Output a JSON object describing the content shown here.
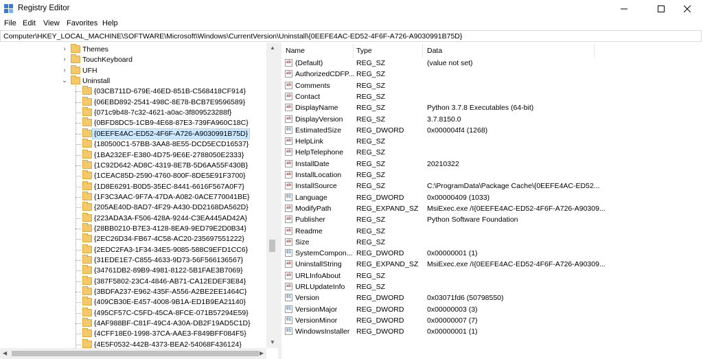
{
  "window": {
    "title": "Registry Editor",
    "minimize": "—",
    "maximize": "☐",
    "close": "✕"
  },
  "menu": [
    "File",
    "Edit",
    "View",
    "Favorites",
    "Help"
  ],
  "address": "Computer\\HKEY_LOCAL_MACHINE\\SOFTWARE\\Microsoft\\Windows\\CurrentVersion\\Uninstall\\{0EEFE4AC-ED52-4F6F-A726-A9030991B75D}",
  "tree": {
    "parents": [
      {
        "label": "Themes",
        "expander": "›"
      },
      {
        "label": "TouchKeyboard",
        "expander": "›"
      },
      {
        "label": "UFH",
        "expander": "›"
      },
      {
        "label": "Uninstall",
        "expander": "⌄"
      }
    ],
    "children": [
      "{03CB711D-679E-46ED-851B-C568418CF914}",
      "{06EBD892-2541-498C-8E78-BCB7E9596589}",
      "{071c9b48-7c32-4621-a0ac-3f809523288f}",
      "{0BFD8DC5-1CB9-4E68-87E3-739FA960C18C}",
      "{0EEFE4AC-ED52-4F6F-A726-A9030991B75D}",
      "{180500C1-57BB-3AA8-8E55-DCD5ECD16537}",
      "{1BA232EF-E380-4D75-9E6E-2788050E2333}",
      "{1C92D642-AD8C-4319-8E7B-5D6AA55F430B}",
      "{1CEAC85D-2590-4760-800F-8DE5E91F3700}",
      "{1D8E6291-B0D5-35EC-8441-6616F567A0F7}",
      "{1F3C3AAC-9F7A-47DA-A082-0ACE770041BE}",
      "{205AE40D-8AD7-4F29-A430-DD2168DA562D}",
      "{223ADA3A-F506-428A-9244-C3EA445AD42A}",
      "{28BB0210-B7E3-4128-8EA9-9ED79E2D0B34}",
      "{2EC26D34-FB67-4C58-AC20-235697551222}",
      "{2EDC2FA3-1F34-34E5-9085-588C9EFD1CC6}",
      "{31EDE1E7-C855-4633-9D73-56F566136567}",
      "{34761DB2-89B9-4981-8122-5B1FAE3B7069}",
      "{387F5802-23C4-4846-AB71-CA12EDEF3E84}",
      "{3BDFA237-E962-435F-A556-A2BE2EE1464C}",
      "{409CB30E-E457-4008-9B1A-ED1B9EA21140}",
      "{495CF57C-C5FD-45CA-8FCE-071B57294E59}",
      "{4AF988BF-C81F-49C4-A30A-DB2F19AD5C1D}",
      "{4CFF18E0-1998-37CA-AAE3-F849BFF084F5}",
      "{4E5F0532-442B-4373-BEA2-54068F436124}"
    ],
    "selected_index": 4
  },
  "list": {
    "headers": {
      "name": "Name",
      "type": "Type",
      "data": "Data"
    },
    "rows": [
      {
        "name": "(Default)",
        "type": "REG_SZ",
        "data": "(value not set)",
        "icon": "ab"
      },
      {
        "name": "AuthorizedCDFP...",
        "type": "REG_SZ",
        "data": "",
        "icon": "ab"
      },
      {
        "name": "Comments",
        "type": "REG_SZ",
        "data": "",
        "icon": "ab"
      },
      {
        "name": "Contact",
        "type": "REG_SZ",
        "data": "",
        "icon": "ab"
      },
      {
        "name": "DisplayName",
        "type": "REG_SZ",
        "data": "Python 3.7.8 Executables (64-bit)",
        "icon": "ab"
      },
      {
        "name": "DisplayVersion",
        "type": "REG_SZ",
        "data": "3.7.8150.0",
        "icon": "ab"
      },
      {
        "name": "EstimatedSize",
        "type": "REG_DWORD",
        "data": "0x000004f4 (1268)",
        "icon": "01"
      },
      {
        "name": "HelpLink",
        "type": "REG_SZ",
        "data": "",
        "icon": "ab"
      },
      {
        "name": "HelpTelephone",
        "type": "REG_SZ",
        "data": "",
        "icon": "ab"
      },
      {
        "name": "InstallDate",
        "type": "REG_SZ",
        "data": "20210322",
        "icon": "ab"
      },
      {
        "name": "InstallLocation",
        "type": "REG_SZ",
        "data": "",
        "icon": "ab"
      },
      {
        "name": "InstallSource",
        "type": "REG_SZ",
        "data": "C:\\ProgramData\\Package Cache\\{0EEFE4AC-ED52...",
        "icon": "ab"
      },
      {
        "name": "Language",
        "type": "REG_DWORD",
        "data": "0x00000409 (1033)",
        "icon": "01"
      },
      {
        "name": "ModifyPath",
        "type": "REG_EXPAND_SZ",
        "data": "MsiExec.exe /I{0EEFE4AC-ED52-4F6F-A726-A90309...",
        "icon": "ab"
      },
      {
        "name": "Publisher",
        "type": "REG_SZ",
        "data": "Python Software Foundation",
        "icon": "ab"
      },
      {
        "name": "Readme",
        "type": "REG_SZ",
        "data": "",
        "icon": "ab"
      },
      {
        "name": "Size",
        "type": "REG_SZ",
        "data": "",
        "icon": "ab"
      },
      {
        "name": "SystemCompon...",
        "type": "REG_DWORD",
        "data": "0x00000001 (1)",
        "icon": "01"
      },
      {
        "name": "UninstallString",
        "type": "REG_EXPAND_SZ",
        "data": "MsiExec.exe /I{0EEFE4AC-ED52-4F6F-A726-A90309...",
        "icon": "ab"
      },
      {
        "name": "URLInfoAbout",
        "type": "REG_SZ",
        "data": "",
        "icon": "ab"
      },
      {
        "name": "URLUpdateInfo",
        "type": "REG_SZ",
        "data": "",
        "icon": "ab"
      },
      {
        "name": "Version",
        "type": "REG_DWORD",
        "data": "0x03071fd6 (50798550)",
        "icon": "01"
      },
      {
        "name": "VersionMajor",
        "type": "REG_DWORD",
        "data": "0x00000003 (3)",
        "icon": "01"
      },
      {
        "name": "VersionMinor",
        "type": "REG_DWORD",
        "data": "0x00000007 (7)",
        "icon": "01"
      },
      {
        "name": "WindowsInstaller",
        "type": "REG_DWORD",
        "data": "0x00000001 (1)",
        "icon": "01"
      }
    ]
  },
  "colors": {
    "selection": "#cce8ff",
    "folder": "#f3c96b"
  }
}
